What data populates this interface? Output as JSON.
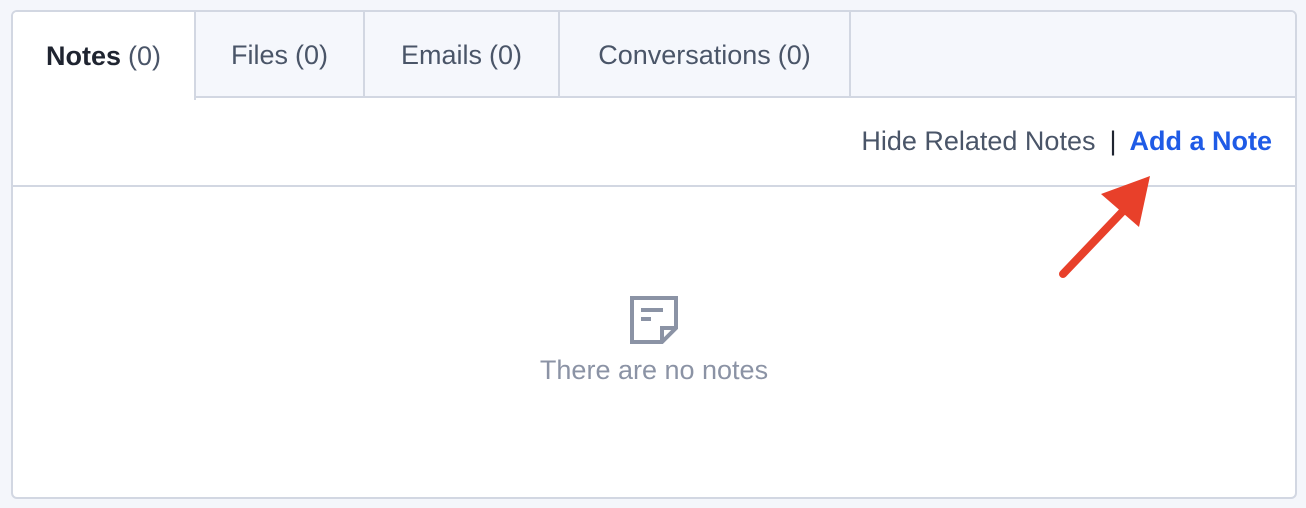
{
  "tabs": [
    {
      "label": "Notes",
      "count": "(0)",
      "active": true
    },
    {
      "label": "Files",
      "count": "(0)",
      "active": false
    },
    {
      "label": "Emails",
      "count": "(0)",
      "active": false
    },
    {
      "label": "Conversations",
      "count": "(0)",
      "active": false
    }
  ],
  "actions": {
    "hide_related": "Hide Related Notes",
    "separator": "|",
    "add_note": "Add a Note"
  },
  "empty_state": {
    "icon": "note-icon",
    "message": "There are no notes"
  },
  "annotation": {
    "icon": "red-arrow-icon",
    "color": "#e8402a"
  },
  "colors": {
    "link_accent": "#1f5be6",
    "border": "#d2d7e2",
    "muted_text": "#8b93a5"
  }
}
